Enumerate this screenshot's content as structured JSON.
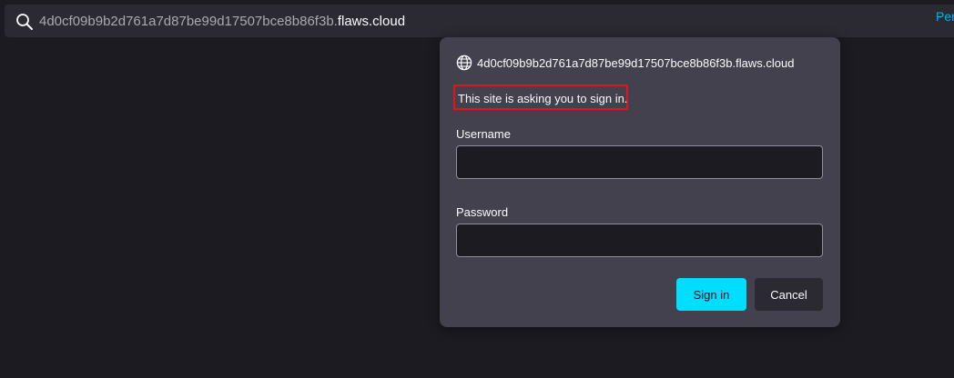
{
  "urlbar": {
    "subdomain": "4d0cf09b9b2d761a7d87be99d17507bce8b86f3b.",
    "domain": "flaws.cloud",
    "right_text": "Per"
  },
  "dialog": {
    "origin": "4d0cf09b9b2d761a7d87be99d17507bce8b86f3b.flaws.cloud",
    "message": "This site is asking you to sign in.",
    "username_label": "Username",
    "username_value": "",
    "password_label": "Password",
    "password_value": "",
    "sign_in_label": "Sign in",
    "cancel_label": "Cancel"
  },
  "icons": {
    "search": "search-icon",
    "globe": "globe-icon"
  },
  "colors": {
    "page_bg": "#1c1b22",
    "urlbar_bg": "#2b2a33",
    "dialog_bg": "#42414d",
    "primary_button": "#00ddff",
    "highlight_box": "#e0141e",
    "link": "#00b3f4"
  }
}
